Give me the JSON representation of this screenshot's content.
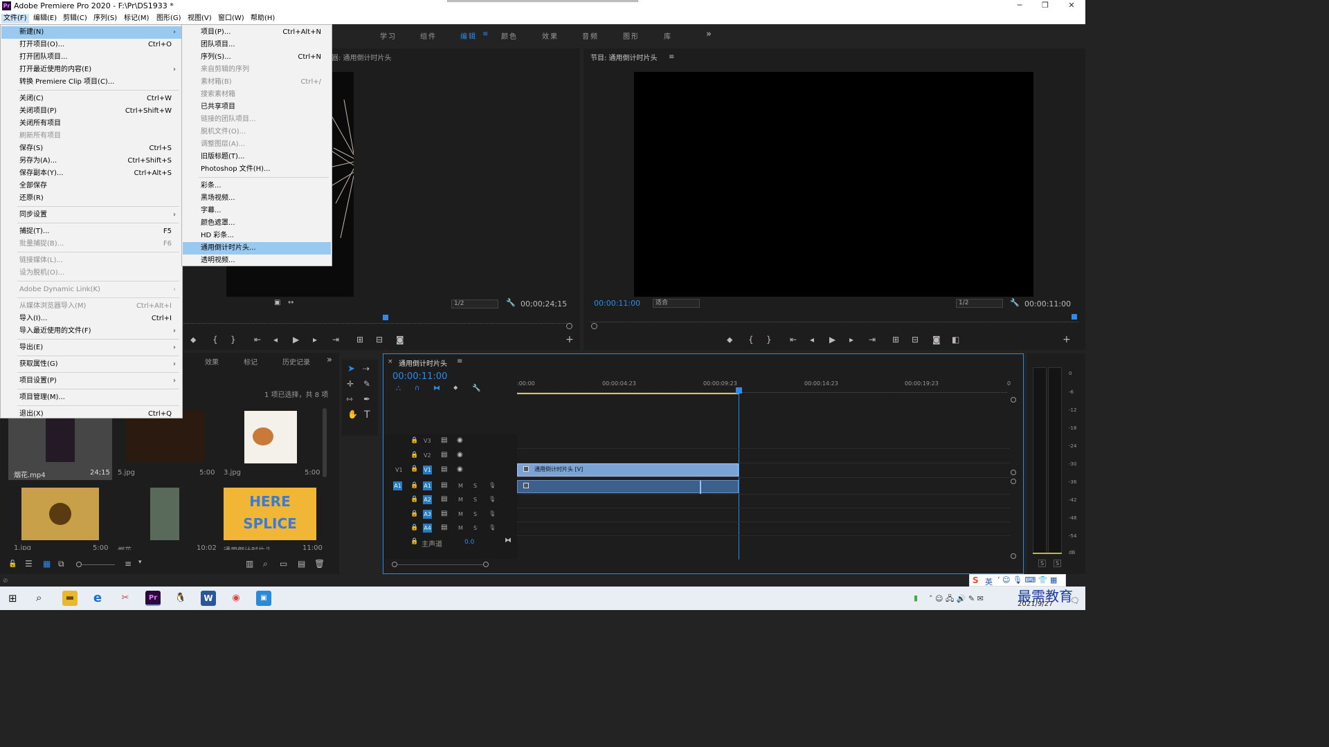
{
  "window": {
    "title": "Adobe Premiere Pro 2020 - F:\\Pr\\DS1933 *",
    "logo": "Pr",
    "minimize": "─",
    "restore": "❐",
    "close": "✕"
  },
  "menubar": [
    "文件(F)",
    "编辑(E)",
    "剪辑(C)",
    "序列(S)",
    "标记(M)",
    "图形(G)",
    "视图(V)",
    "窗口(W)",
    "帮助(H)"
  ],
  "workspaces": [
    "学习",
    "组件",
    "编辑",
    "颜色",
    "效果",
    "音频",
    "图形",
    "库"
  ],
  "workspace_active": "编辑",
  "workspace_more": "»",
  "file_menu": [
    {
      "label": "新建(N)",
      "shortcut": "",
      "arrow": true,
      "disabled": false,
      "highlight": true
    },
    {
      "label": "打开项目(O)...",
      "shortcut": "Ctrl+O"
    },
    {
      "label": "打开团队项目...",
      "shortcut": ""
    },
    {
      "label": "打开最近使用的内容(E)",
      "shortcut": "",
      "arrow": true
    },
    {
      "label": "转换 Premiere Clip 项目(C)...",
      "shortcut": ""
    },
    {
      "sep": true
    },
    {
      "label": "关闭(C)",
      "shortcut": "Ctrl+W"
    },
    {
      "label": "关闭项目(P)",
      "shortcut": "Ctrl+Shift+W"
    },
    {
      "label": "关闭所有项目",
      "shortcut": ""
    },
    {
      "label": "刷新所有项目",
      "shortcut": "",
      "disabled": true
    },
    {
      "label": "保存(S)",
      "shortcut": "Ctrl+S"
    },
    {
      "label": "另存为(A)...",
      "shortcut": "Ctrl+Shift+S"
    },
    {
      "label": "保存副本(Y)...",
      "shortcut": "Ctrl+Alt+S"
    },
    {
      "label": "全部保存",
      "shortcut": ""
    },
    {
      "label": "还原(R)",
      "shortcut": ""
    },
    {
      "sep": true
    },
    {
      "label": "同步设置",
      "shortcut": "",
      "arrow": true
    },
    {
      "sep": true
    },
    {
      "label": "捕捉(T)...",
      "shortcut": "F5"
    },
    {
      "label": "批量捕捉(B)...",
      "shortcut": "F6",
      "disabled": true
    },
    {
      "sep": true
    },
    {
      "label": "链接媒体(L)...",
      "shortcut": "",
      "disabled": true
    },
    {
      "label": "设为脱机(O)...",
      "shortcut": "",
      "disabled": true
    },
    {
      "sep": true
    },
    {
      "label": "Adobe Dynamic Link(K)",
      "shortcut": "",
      "arrow": true,
      "disabled": true
    },
    {
      "sep": true
    },
    {
      "label": "从媒体浏览器导入(M)",
      "shortcut": "Ctrl+Alt+I",
      "disabled": true
    },
    {
      "label": "导入(I)...",
      "shortcut": "Ctrl+I"
    },
    {
      "label": "导入最近使用的文件(F)",
      "shortcut": "",
      "arrow": true
    },
    {
      "sep": true
    },
    {
      "label": "导出(E)",
      "shortcut": "",
      "arrow": true
    },
    {
      "sep": true
    },
    {
      "label": "获取属性(G)",
      "shortcut": "",
      "arrow": true
    },
    {
      "sep": true
    },
    {
      "label": "项目设置(P)",
      "shortcut": "",
      "arrow": true
    },
    {
      "sep": true
    },
    {
      "label": "项目管理(M)...",
      "shortcut": ""
    },
    {
      "sep": true
    },
    {
      "label": "退出(X)",
      "shortcut": "Ctrl+Q"
    }
  ],
  "new_submenu": [
    {
      "label": "项目(P)...",
      "shortcut": "Ctrl+Alt+N"
    },
    {
      "label": "团队项目...",
      "shortcut": ""
    },
    {
      "label": "序列(S)...",
      "shortcut": "Ctrl+N"
    },
    {
      "label": "来自剪辑的序列",
      "shortcut": "",
      "disabled": true
    },
    {
      "label": "素材箱(B)",
      "shortcut": "Ctrl+/",
      "disabled": true
    },
    {
      "label": "搜索素材箱",
      "shortcut": "",
      "disabled": true
    },
    {
      "label": "已共享项目",
      "shortcut": ""
    },
    {
      "label": "链接的团队项目...",
      "shortcut": "",
      "disabled": true
    },
    {
      "label": "脱机文件(O)...",
      "shortcut": "",
      "disabled": true
    },
    {
      "label": "调整图层(A)...",
      "shortcut": "",
      "disabled": true
    },
    {
      "label": "旧版标题(T)...",
      "shortcut": ""
    },
    {
      "label": "Photoshop 文件(H)...",
      "shortcut": ""
    },
    {
      "sep": true
    },
    {
      "label": "彩条...",
      "shortcut": ""
    },
    {
      "label": "黑场视频...",
      "shortcut": ""
    },
    {
      "label": "字幕...",
      "shortcut": ""
    },
    {
      "label": "颜色遮罩...",
      "shortcut": ""
    },
    {
      "label": "HD 彩条...",
      "shortcut": ""
    },
    {
      "label": "通用倒计时片头...",
      "shortcut": "",
      "highlight": true
    },
    {
      "label": "透明视频...",
      "shortcut": ""
    }
  ],
  "source_monitor": {
    "title": "器: 通用倒计时片头",
    "zoom": "1/2",
    "timecode": "00;00;24;15"
  },
  "program_monitor": {
    "title": "节目: 通用倒计时片头",
    "current_time": "00:00:11:00",
    "fit": "适合",
    "zoom": "1/2",
    "duration": "00:00:11:00"
  },
  "project_panel": {
    "tabs": [
      "效果",
      "标记",
      "历史记录"
    ],
    "selection_info": "1 项已选择，共 8 项",
    "items": [
      {
        "name": "烟花.mp4",
        "duration": "24;15"
      },
      {
        "name": "5.jpg",
        "duration": "5:00"
      },
      {
        "name": "3.jpg",
        "duration": "5:00"
      },
      {
        "name": "1.jpg",
        "duration": "5:00"
      },
      {
        "name": "烟花",
        "duration": "10:02"
      },
      {
        "name": "通用倒计时片头",
        "duration": "11:00"
      }
    ],
    "here_splice": "HERE SPLICE"
  },
  "timeline": {
    "tab": "通用倒计时片头",
    "timecode": "00:00:11:00",
    "ruler": [
      ":00:00",
      "00:00:04:23",
      "00:00:09:23",
      "00:00:14:23",
      "00:00:19:23",
      "0"
    ],
    "video_tracks": [
      "V3",
      "V2",
      "V1"
    ],
    "audio_tracks": [
      "A1",
      "A2",
      "A3",
      "A4"
    ],
    "source_patch_v": "V1",
    "source_patch_a": "A1",
    "mute": "M",
    "solo": "S",
    "master": "主声道",
    "master_value": "0.0",
    "clip_label": "通用倒计时片头 [V]"
  },
  "audio_meter": {
    "scale": [
      "0",
      "-6",
      "-12",
      "-18",
      "-24",
      "-30",
      "-36",
      "-42",
      "-48",
      "-54",
      "dB"
    ],
    "solo_l": "S",
    "solo_r": "S"
  },
  "taskbar": {
    "time": "",
    "date": "2021/9/27",
    "ime": "英",
    "watermark": "最需教育"
  }
}
